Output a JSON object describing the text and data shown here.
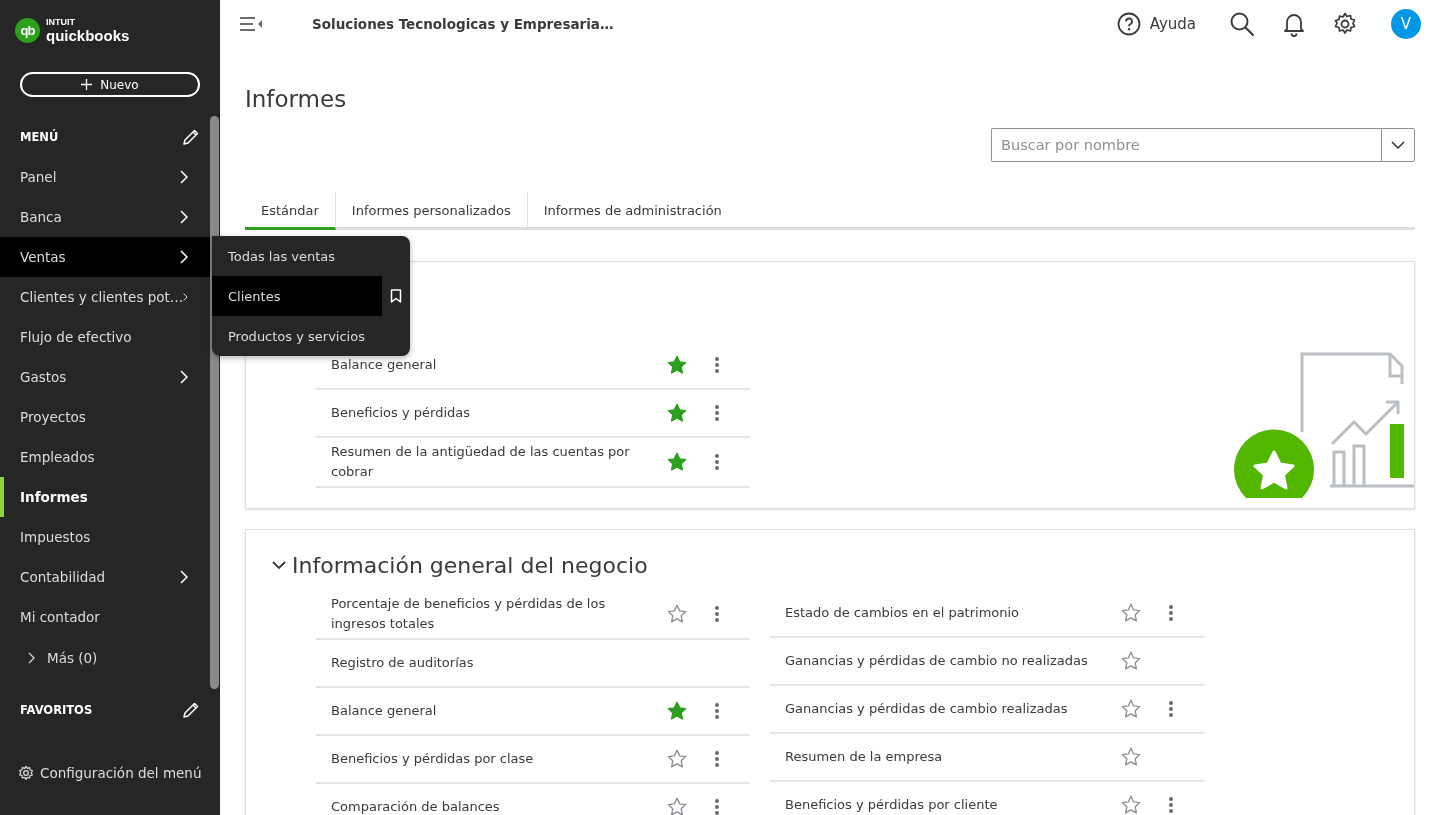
{
  "brand": {
    "top": "INTUIT",
    "bottom": "quickbooks",
    "mark": "qb"
  },
  "new_button": "Nuevo",
  "menu": {
    "heading": "MENÚ",
    "items": [
      {
        "label": "Panel",
        "has_submenu": true,
        "selected": false,
        "highlighted": false
      },
      {
        "label": "Banca",
        "has_submenu": true,
        "selected": false,
        "highlighted": false
      },
      {
        "label": "Ventas",
        "has_submenu": true,
        "selected": false,
        "highlighted": true
      },
      {
        "label": "Clientes y clientes pot…",
        "has_submenu": true,
        "selected": false,
        "highlighted": false
      },
      {
        "label": "Flujo de efectivo",
        "has_submenu": false,
        "selected": false,
        "highlighted": false
      },
      {
        "label": "Gastos",
        "has_submenu": true,
        "selected": false,
        "highlighted": false
      },
      {
        "label": "Proyectos",
        "has_submenu": false,
        "selected": false,
        "highlighted": false
      },
      {
        "label": "Empleados",
        "has_submenu": false,
        "selected": false,
        "highlighted": false
      },
      {
        "label": "Informes",
        "has_submenu": false,
        "selected": true,
        "highlighted": false
      },
      {
        "label": "Impuestos",
        "has_submenu": false,
        "selected": false,
        "highlighted": false
      },
      {
        "label": "Contabilidad",
        "has_submenu": true,
        "selected": false,
        "highlighted": false
      },
      {
        "label": "Mi contador",
        "has_submenu": false,
        "selected": false,
        "highlighted": false
      }
    ],
    "more": "Más (0)"
  },
  "favorites_heading": "FAVORITOS",
  "menu_settings": "Configuración del menú",
  "flyout": [
    {
      "label": "Todas las ventas",
      "selected": false
    },
    {
      "label": "Clientes",
      "selected": true
    },
    {
      "label": "Productos y servicios",
      "selected": false
    }
  ],
  "company": "Soluciones Tecnologicas y Empresaria…",
  "help": "Ayuda",
  "avatar": "V",
  "page_title": "Informes",
  "search": {
    "placeholder": "Buscar por nombre"
  },
  "tabs": [
    {
      "label": "Estándar",
      "selected": true
    },
    {
      "label": "Informes personalizados",
      "selected": false
    },
    {
      "label": "Informes de administración",
      "selected": false
    }
  ],
  "favorites_card": {
    "columns": [
      [
        {
          "label": "Balance general",
          "kind": "full",
          "favorite": true
        },
        {
          "label": "Beneficios y pérdidas",
          "kind": "full",
          "favorite": true
        },
        {
          "label": "Resumen de la antigüedad de las cuentas por cobrar",
          "kind": "full",
          "favorite": true
        }
      ]
    ]
  },
  "business_card": {
    "title": "Información general del negocio",
    "expanded": true,
    "columns": [
      [
        {
          "label": "Porcentaje de beneficios y pérdidas de los ingresos totales",
          "kind": "full",
          "favorite": false
        },
        {
          "label": "Registro de auditorías",
          "kind": "plain"
        },
        {
          "label": "Balance general",
          "kind": "full",
          "favorite": true
        },
        {
          "label": "Beneficios y pérdidas por clase",
          "kind": "full",
          "favorite": false
        },
        {
          "label": "Comparación de balances",
          "kind": "full",
          "favorite": false
        }
      ],
      [
        {
          "label": "Estado de cambios en el patrimonio",
          "kind": "full",
          "favorite": false
        },
        {
          "label": "Ganancias y pérdidas de cambio no realizadas",
          "kind": "star",
          "favorite": false
        },
        {
          "label": "Ganancias y pérdidas de cambio realizadas",
          "kind": "full",
          "favorite": false
        },
        {
          "label": "Resumen de la empresa",
          "kind": "star",
          "favorite": false
        },
        {
          "label": "Beneficios y pérdidas por cliente",
          "kind": "full",
          "favorite": false
        }
      ]
    ]
  }
}
